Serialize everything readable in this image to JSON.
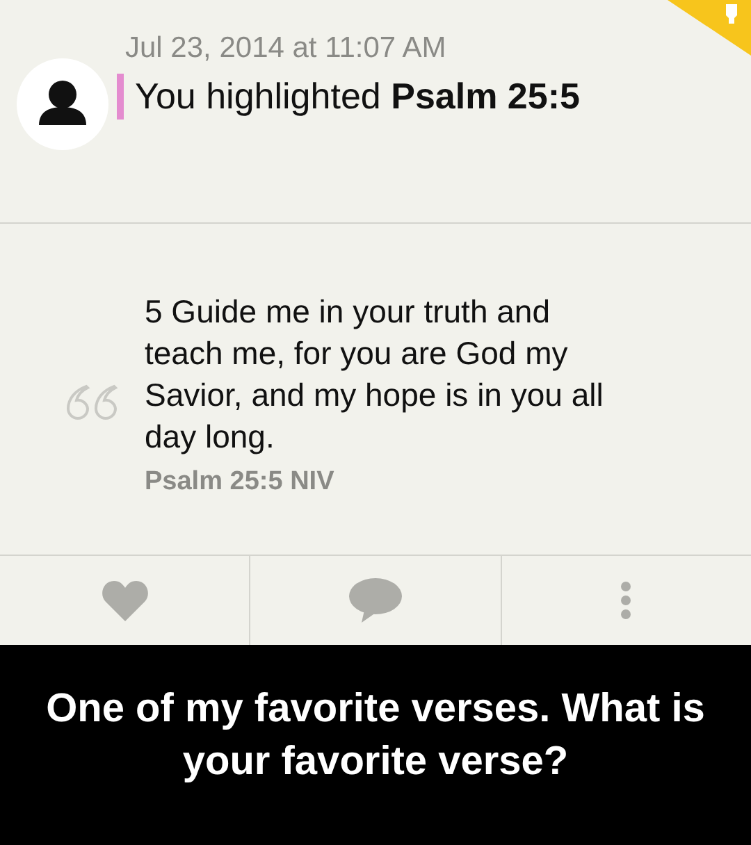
{
  "post": {
    "date": "Jul 23, 2014 at 11:07 AM",
    "headline": "You highlighted **Psalm 25:5**",
    "verse": "5 Guide me in your truth and teach me, for you are God my Savior, and my hope is in you all day long.",
    "reference": "Psalm 25:5 NIV"
  },
  "actions": [
    {
      "kind": "like"
    },
    {
      "kind": "comment"
    },
    {
      "kind": "more"
    }
  ],
  "caption": "One of my favorite verses. What is your favorite verse?"
}
